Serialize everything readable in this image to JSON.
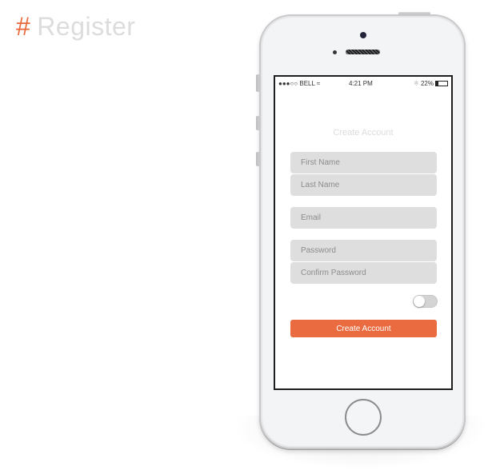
{
  "page": {
    "title_prefix": "#",
    "title": "Register"
  },
  "status_bar": {
    "carrier": "●●●○○ BELL",
    "wifi_icon": "wifi-icon",
    "time": "4:21 PM",
    "bluetooth_icon": "bluetooth-icon",
    "battery_percent": "22%",
    "battery_level": 0.22
  },
  "form": {
    "title": "Create Account",
    "fields": [
      {
        "placeholder": "First Name",
        "value": ""
      },
      {
        "placeholder": "Last Name",
        "value": ""
      },
      {
        "placeholder": "Email",
        "value": ""
      },
      {
        "placeholder": "Password",
        "value": ""
      },
      {
        "placeholder": "Confirm Password",
        "value": ""
      }
    ],
    "toggle_on": false,
    "submit_label": "Create Account"
  },
  "colors": {
    "accent": "#e96b3f",
    "field_bg": "#dedede"
  }
}
